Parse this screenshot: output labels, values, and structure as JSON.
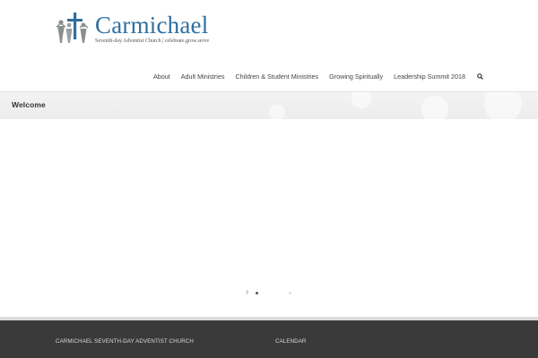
{
  "brand": {
    "name": "Carmichael",
    "tagline": "Seventh-day Adventist Church | celebrate.grow.serve",
    "colors": {
      "primary": "#2f6f9f",
      "secondary": "#8a8f92",
      "footer_bg": "#3a3a3a"
    }
  },
  "nav": {
    "items": [
      {
        "label": "About"
      },
      {
        "label": "Adult Ministries"
      },
      {
        "label": "Children & Student Ministries"
      },
      {
        "label": "Growing Spiritually"
      },
      {
        "label": "Leadership Summit 2018"
      }
    ],
    "search_icon": "search-icon"
  },
  "page": {
    "title": "Welcome"
  },
  "slider": {
    "next_glyph": "›",
    "dot_count": 2,
    "active_dot": 1
  },
  "footer": {
    "col1_heading": "CARMICHAEL SEVENTH-DAY ADVENTIST CHURCH",
    "col2_heading": "CALENDAR"
  }
}
